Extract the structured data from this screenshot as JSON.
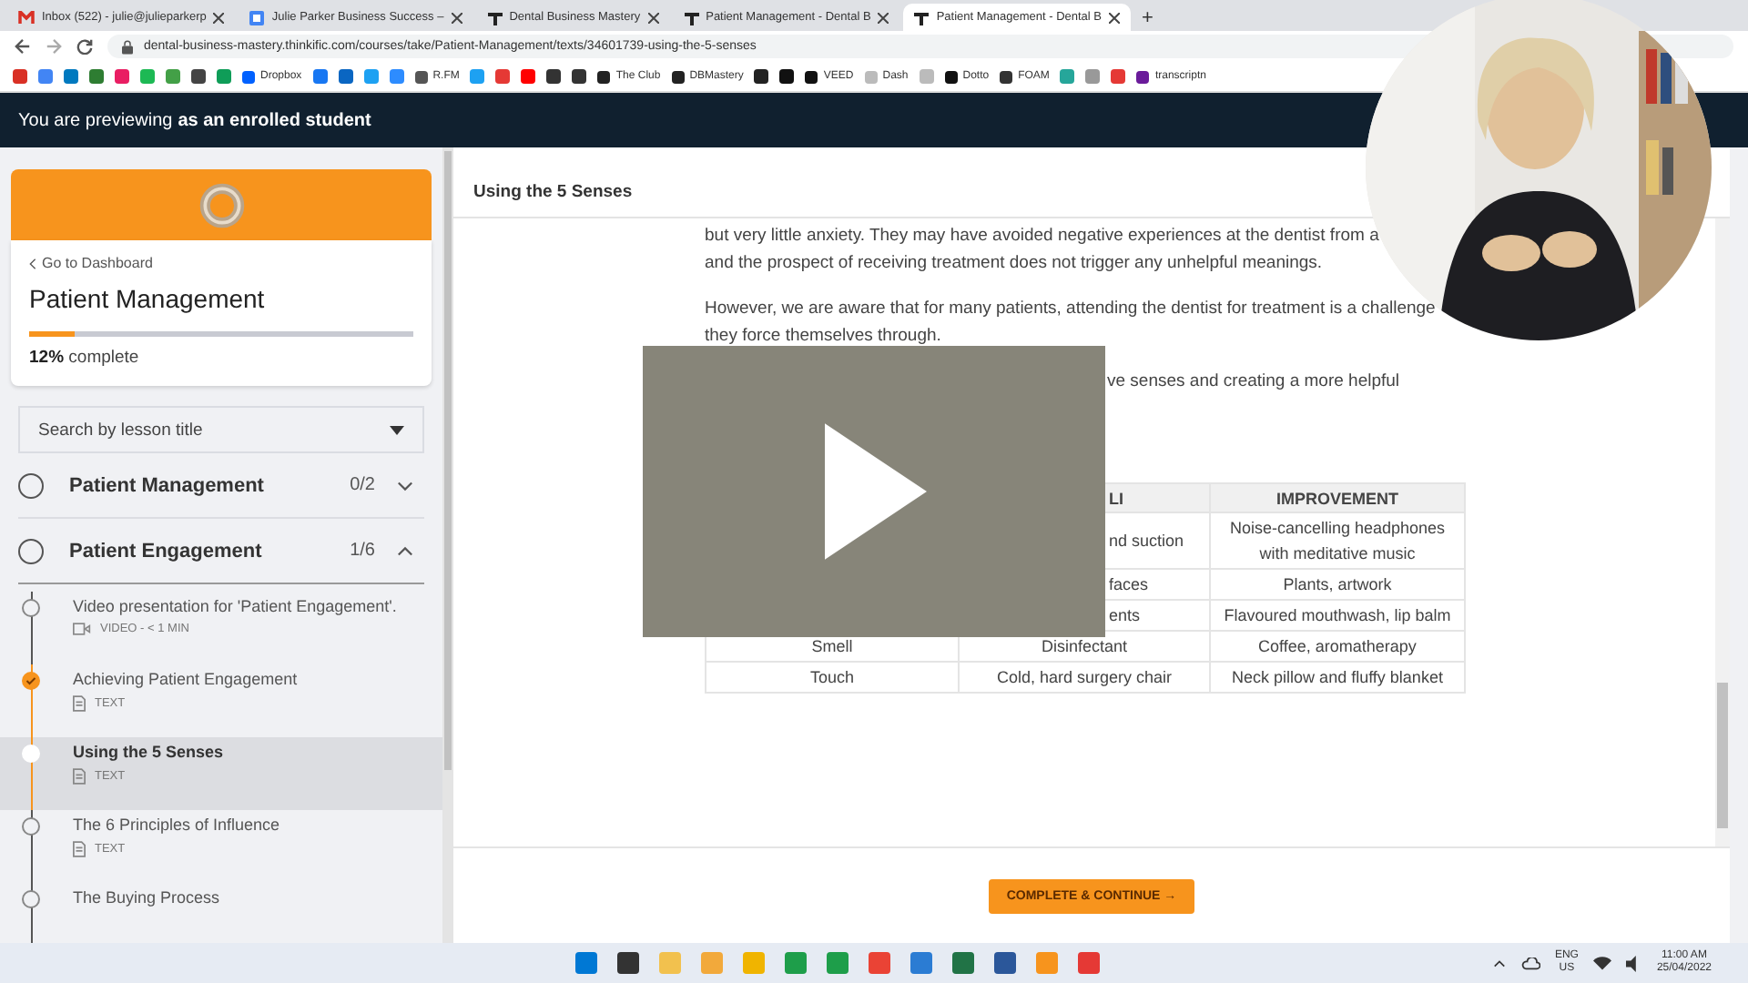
{
  "browser": {
    "tabs": [
      {
        "title": "Inbox (522) - julie@julieparkerp",
        "selected": false
      },
      {
        "title": "Julie Parker Business Success –",
        "selected": false
      },
      {
        "title": "Dental Business Mastery",
        "selected": false
      },
      {
        "title": "Patient Management - Dental B",
        "selected": false
      },
      {
        "title": "Patient Management - Dental B",
        "selected": true
      }
    ],
    "new_tab": "+",
    "address": "dental-business-mastery.thinkific.com/courses/take/Patient-Management/texts/34601739-using-the-5-senses",
    "bookmarks": [
      {
        "kind": "icon"
      },
      {
        "kind": "icon"
      },
      {
        "kind": "icon"
      },
      {
        "kind": "icon"
      },
      {
        "kind": "icon"
      },
      {
        "kind": "icon"
      },
      {
        "kind": "icon"
      },
      {
        "kind": "icon"
      },
      {
        "kind": "icon"
      },
      {
        "kind": "link",
        "label": "Dropbox"
      },
      {
        "kind": "icon"
      },
      {
        "kind": "icon"
      },
      {
        "kind": "icon"
      },
      {
        "kind": "icon"
      },
      {
        "kind": "link",
        "label": "R.FM"
      },
      {
        "kind": "icon"
      },
      {
        "kind": "icon"
      },
      {
        "kind": "icon"
      },
      {
        "kind": "icon"
      },
      {
        "kind": "icon"
      },
      {
        "kind": "link",
        "label": "The Club"
      },
      {
        "kind": "link",
        "label": "DBMastery"
      },
      {
        "kind": "icon"
      },
      {
        "kind": "icon"
      },
      {
        "kind": "link",
        "label": "VEED"
      },
      {
        "kind": "link",
        "label": "Dash"
      },
      {
        "kind": "icon"
      },
      {
        "kind": "link",
        "label": "Dotto"
      },
      {
        "kind": "link",
        "label": "FOAM"
      },
      {
        "kind": "icon"
      },
      {
        "kind": "icon"
      },
      {
        "kind": "icon"
      },
      {
        "kind": "link",
        "label": "transcriptn"
      }
    ]
  },
  "preview_banner": "You are previewing **as an enrolled student**",
  "sidebar": {
    "back_link": "Go to Dashboard",
    "course_title": "Patient Management",
    "progress": {
      "level": 0.12,
      "percent": "12%",
      "label": "complete"
    },
    "search": {
      "placeholder": "Search by lesson title"
    },
    "chapters": [
      {
        "title": "Patient Management",
        "count": "0/2",
        "expanded": false
      },
      {
        "title": "Patient Engagement",
        "count": "1/6",
        "expanded": true,
        "children": [
          {
            "title": "Video presentation for 'Patient Engagement'.",
            "kind": "video",
            "meta": "VIDEO - < 1 MIN",
            "completed": false,
            "selected": false
          },
          {
            "title": "Achieving Patient Engagement",
            "kind": "text",
            "meta": "TEXT",
            "completed": true,
            "selected": false
          },
          {
            "title": "Using the 5 Senses",
            "kind": "text",
            "meta": "TEXT",
            "completed": false,
            "selected": true
          },
          {
            "title": "The 6 Principles of Influence",
            "kind": "text",
            "meta": "TEXT",
            "completed": false,
            "selected": false
          },
          {
            "title": "The Buying Process",
            "completed": false,
            "selected": false
          }
        ]
      }
    ]
  },
  "lesson": {
    "title": "Using the 5 Senses",
    "paragraphs": [
      [
        "but very little anxiety. They may have avoided negative experiences at the dentist from a",
        "and the prospect of receiving treatment does not trigger any unhelpful meanings."
      ],
      [
        "However, we are aware that for many patients, attending the dentist for treatment is a challenge",
        "they force themselves through."
      ],
      [
        "ve senses and creating a more helpful"
      ]
    ],
    "table": {
      "columns": [
        "",
        "LI",
        "IMPROVEMENT"
      ],
      "rows": [
        [
          "",
          "nd suction",
          "Noise-cancelling headphones with meditative music"
        ],
        [
          "",
          "faces",
          "Plants, artwork"
        ],
        [
          "",
          "ents",
          "Flavoured mouthwash, lip balm"
        ],
        [
          "Smell",
          "Disinfectant",
          "Coffee, aromatherapy"
        ],
        [
          "Touch",
          "Cold, hard surgery chair",
          "Neck pillow and fluffy blanket"
        ]
      ]
    },
    "complete_button": "COMPLETE & CONTINUE →"
  },
  "taskbar": {
    "language": "ENG",
    "region": "US",
    "time": "11:00 AM",
    "date": "25/04/2022"
  }
}
